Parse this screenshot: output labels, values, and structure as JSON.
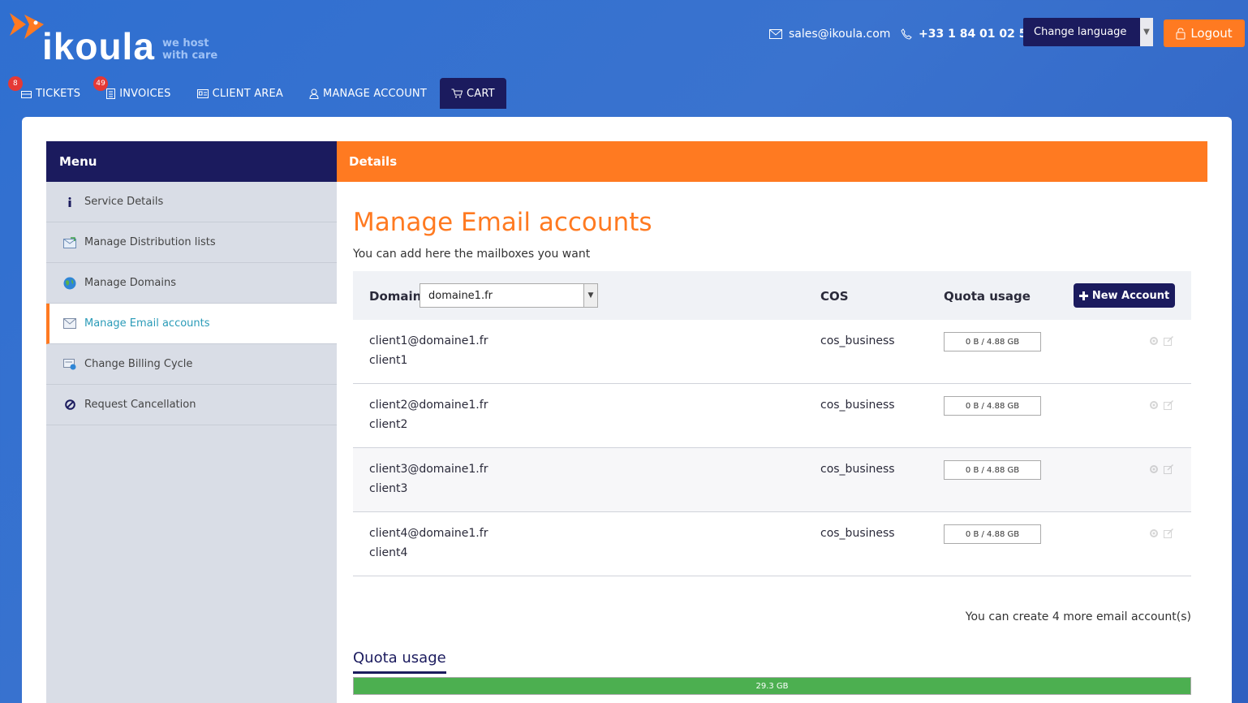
{
  "header": {
    "logo_word": "ikoula",
    "logo_tagline_1": "we host",
    "logo_tagline_2": "with care",
    "email": "sales@ikoula.com",
    "phone": "+33 1 84 01 02 50",
    "language_select": "Change language",
    "logout": "Logout"
  },
  "nav": {
    "items": [
      {
        "label": "TICKETS",
        "badge": "8",
        "icon": "ticket-icon"
      },
      {
        "label": "INVOICES",
        "badge": "49",
        "icon": "invoice-icon"
      },
      {
        "label": "CLIENT AREA",
        "icon": "id-card-icon"
      },
      {
        "label": "MANAGE ACCOUNT",
        "icon": "user-icon"
      },
      {
        "label": "CART",
        "icon": "cart-icon"
      }
    ]
  },
  "sidebar": {
    "title": "Menu",
    "items": [
      {
        "label": "Service Details",
        "icon": "info-icon"
      },
      {
        "label": "Manage Distribution lists",
        "icon": "distribution-list-icon"
      },
      {
        "label": "Manage Domains",
        "icon": "globe-icon"
      },
      {
        "label": "Manage Email accounts",
        "icon": "email-accounts-icon",
        "active": true
      },
      {
        "label": "Change Billing Cycle",
        "icon": "billing-cycle-icon"
      },
      {
        "label": "Request Cancellation",
        "icon": "cancel-icon"
      }
    ]
  },
  "content": {
    "header": "Details",
    "title": "Manage Email accounts",
    "subtitle": "You can add here the mailboxes you want",
    "table": {
      "domain_label": "Domain",
      "domain_value": "domaine1.fr",
      "cos_label": "COS",
      "quota_label": "Quota usage",
      "new_account": "New Account",
      "rows": [
        {
          "email": "client1@domaine1.fr",
          "name": "client1",
          "cos": "cos_business",
          "quota": "0 B / 4.88 GB"
        },
        {
          "email": "client2@domaine1.fr",
          "name": "client2",
          "cos": "cos_business",
          "quota": "0 B / 4.88 GB"
        },
        {
          "email": "client3@domaine1.fr",
          "name": "client3",
          "cos": "cos_business",
          "quota": "0 B / 4.88 GB"
        },
        {
          "email": "client4@domaine1.fr",
          "name": "client4",
          "cos": "cos_business",
          "quota": "0 B / 4.88 GB"
        }
      ]
    },
    "remaining": "You can create 4 more email account(s)",
    "quota_title": "Quota usage",
    "quota_bar_label": "29.3 GB",
    "quota_bar_fraction": 1.0
  },
  "colors": {
    "accent_orange": "#ff7a21",
    "navy": "#1b1b5e",
    "background_blue": "#3a73cf",
    "quota_green": "#4caf50",
    "badge_red": "#e53935"
  }
}
